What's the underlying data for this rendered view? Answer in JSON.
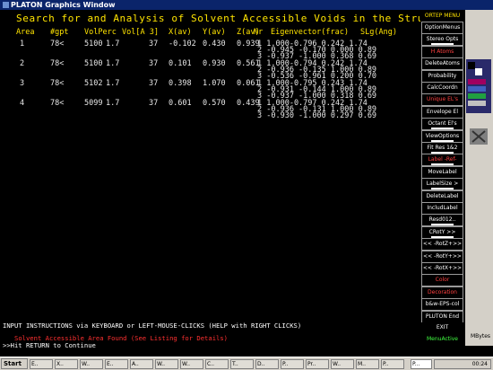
{
  "window": {
    "title": "PLATON Graphics Window"
  },
  "heading": "Search for and Analysis of Solvent Accessible Voids in the Structure",
  "columns": [
    "Area",
    "#gpt",
    "VolPerc",
    "Vol[A 3]",
    "X(av)",
    "Y(av)",
    "Z(av)",
    "Nr",
    "Eigenvector(frac)",
    "SLg(Ang)"
  ],
  "voids": [
    {
      "area": "1",
      "gpt": "78<",
      "volperc": "5100",
      "vol": "1.7",
      "x": "37",
      "xav": "-0.102",
      "yav": "0.430",
      "zav": "0.939",
      "ev": [
        "1   1.000-0.796 0.242    1.74",
        "2 -0.945 -0.170 0.000    0.89",
        "3 -0.937 -1.000 0.368    0.69"
      ]
    },
    {
      "area": "2",
      "gpt": "78<",
      "volperc": "5100",
      "vol": "1.7",
      "x": "37",
      "xav": "0.101",
      "yav": "0.930",
      "zav": "0.561",
      "ev": [
        "1   1.000-0.794 0.242    1.74",
        "2 -0.936 -0.135 1.000    0.89",
        "3 -0.536 -0.961 0.200    0.70"
      ]
    },
    {
      "area": "3",
      "gpt": "78<",
      "volperc": "5102",
      "vol": "1.7",
      "x": "37",
      "xav": "0.398",
      "yav": "1.070",
      "zav": "0.061",
      "ev": [
        "1   1.000-0.795 0.243    1.74",
        "2 -0.931 -0.144 1.000    0.89",
        "3 -0.937 -1.000 0.318    0.69"
      ]
    },
    {
      "area": "4",
      "gpt": "78<",
      "volperc": "5099",
      "vol": "1.7",
      "x": "37",
      "xav": "0.601",
      "yav": "0.570",
      "zav": "0.439",
      "ev": [
        "1   1.000-0.797 0.242    1.74",
        "2 -0.936 -0.131 1.000    0.89",
        "3 -0.930 -1.000 0.297    0.69"
      ]
    }
  ],
  "menu": {
    "header": "ORTEP MENU",
    "items": [
      {
        "label": "OptionMenus",
        "color": "white"
      },
      {
        "label": "Stereo Opts",
        "color": "white"
      },
      {
        "label": "H Atoms",
        "color": "red"
      },
      {
        "label": "DeleteAtoms",
        "color": "white"
      },
      {
        "label": "Probability",
        "color": "white"
      },
      {
        "label": "CalcCoordn",
        "color": "white"
      },
      {
        "label": "Unique EL's",
        "color": "red"
      },
      {
        "label": "Envelope El",
        "color": "white"
      },
      {
        "label": "Octant El's",
        "color": "white"
      },
      {
        "label": "ViewOptions",
        "color": "white"
      },
      {
        "label": "Fit Res 1&2",
        "color": "white"
      },
      {
        "label": "Label -Ref-",
        "color": "red"
      },
      {
        "label": "MoveLabel",
        "color": "white"
      },
      {
        "label": "LabelSize >",
        "color": "white"
      },
      {
        "label": "DeleteLabel",
        "color": "white"
      },
      {
        "label": "IncludLabel",
        "color": "white"
      },
      {
        "label": "Resd012..",
        "color": "white"
      },
      {
        "label": "CRotY >>",
        "color": "white"
      },
      {
        "label": "<< -RotZ+>>",
        "color": "white"
      },
      {
        "label": "<< -RotY+>>",
        "color": "white"
      },
      {
        "label": "<< -RotX+>>",
        "color": "white"
      },
      {
        "label": "Color",
        "color": "red"
      },
      {
        "label": "Decoration",
        "color": "red"
      },
      {
        "label": "b&w-EPS-col",
        "color": "white"
      },
      {
        "label": "PLUTON  End",
        "color": "white"
      },
      {
        "label": "EXIT",
        "color": "white"
      },
      {
        "label": "MenuActive",
        "color": "green"
      }
    ]
  },
  "bottom": {
    "instructions": "INPUT INSTRUCTIONS via KEYBOARD or LEFT-MOUSE-CLICKS (HELP with RIGHT CLICKS)",
    "found": "Solvent Accessible Area Found (See Listing for Details)",
    "hit": ">>Hit RETURN to Continue"
  },
  "memory": "MBytes",
  "taskbar": {
    "start": "Start",
    "tasks": [
      "E..",
      "X..",
      "W..",
      "E..",
      "A..",
      "W..",
      "W..",
      "C..",
      "T..",
      "D..",
      "P..",
      "Pr..",
      "W..",
      "M..",
      "P.."
    ],
    "active": "P...",
    "clock": "00:24"
  },
  "colors": {
    "yellow": "#ffe400",
    "red": "#ff4040",
    "green": "#40ff40",
    "titlebar": "#0a246a"
  }
}
